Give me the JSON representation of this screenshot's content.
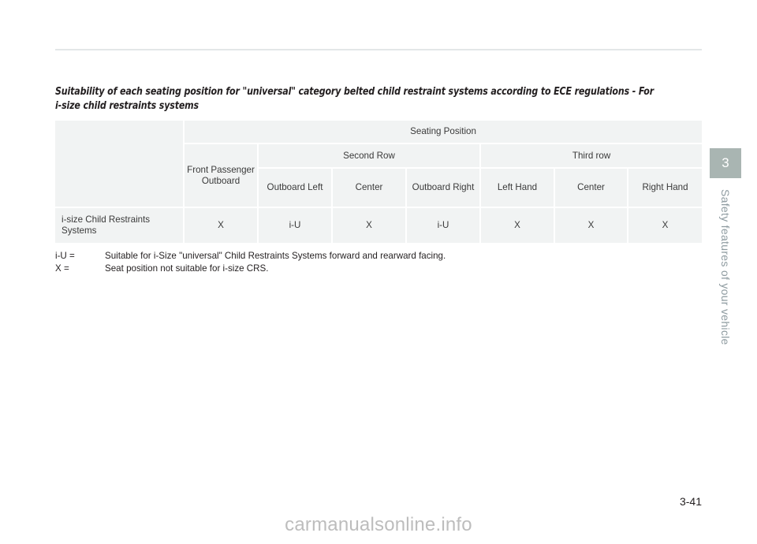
{
  "document": {
    "section_title": "Suitability of each seating position for \"universal\" category belted child restraint systems according to ECE regulations - For i-size child restraints systems",
    "page_number": "3-41",
    "watermark": "carmanualsonline.info"
  },
  "chapter": {
    "number": "3",
    "label": "Safety features of your vehicle"
  },
  "table": {
    "top_header": "Seating Position",
    "groups": {
      "front": "Front Passenger Outboard",
      "second_row": "Second Row",
      "third_row": "Third row"
    },
    "columns": [
      "Outboard Left",
      "Center",
      "Outboard Right",
      "Left Hand",
      "Center",
      "Right Hand"
    ],
    "rows": [
      {
        "label": "i-size Child Restraints Systems",
        "values": [
          "X",
          "i-U",
          "X",
          "i-U",
          "X",
          "X",
          "X"
        ]
      }
    ]
  },
  "legend": [
    {
      "key": "i-U =",
      "description": "Suitable for i-Size \"universal\" Child Restraints Systems forward and rearward facing."
    },
    {
      "key": "X =",
      "description": "Seat position not suitable for i-size CRS."
    }
  ]
}
